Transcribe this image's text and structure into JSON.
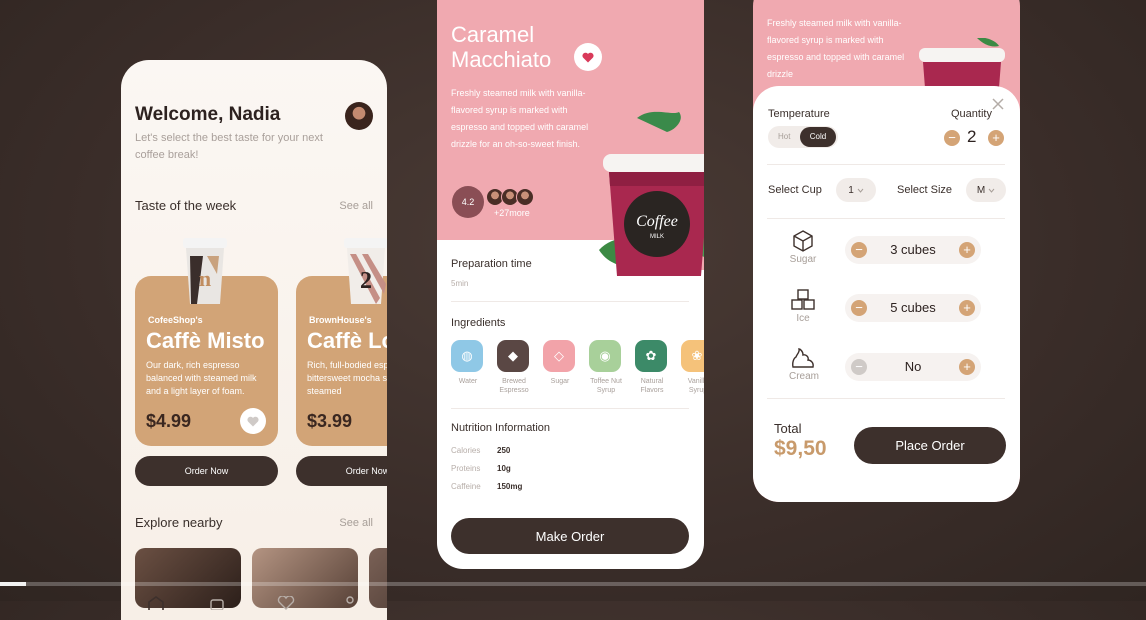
{
  "home": {
    "greeting": "Welcome, Nadia",
    "subtitle": "Let's select the best taste for your next coffee break!",
    "taste_title": "Taste of the week",
    "see_all": "See all",
    "cards": [
      {
        "shop": "CofeeShop's",
        "name": "Caffè Misto",
        "desc": "Our dark, rich espresso balanced with steamed milk and a light layer of foam.",
        "price": "$4.99",
        "cup_label": "n",
        "button": "Order Now"
      },
      {
        "shop": "BrownHouse's",
        "name": "Caffè Lo",
        "desc": "Rich, full-bodied espresso with bittersweet mocha sauce and steamed",
        "price": "$3.99",
        "cup_label": "2",
        "button": "Order Now"
      }
    ],
    "nearby_title": "Explore nearby",
    "nearby_see_all": "See all"
  },
  "detail": {
    "title_line1": "Caramel",
    "title_line2": "Macchiato",
    "description": "Freshly steamed milk with vanilla-flavored syrup is marked with espresso and topped with caramel drizzle for an oh-so-sweet finish.",
    "rating": "4.2",
    "more": "+27more",
    "prep_label": "Preparation time",
    "prep_value": "5min",
    "ingredients_label": "Ingredients",
    "ingredients": [
      {
        "name": "Water",
        "color": "#8fc8e6"
      },
      {
        "name": "Brewed Espresso",
        "color": "#5a4744"
      },
      {
        "name": "Sugar",
        "color": "#f2a3a9"
      },
      {
        "name": "Toffee Nut Syrup",
        "color": "#a8d09a"
      },
      {
        "name": "Natural Flavors",
        "color": "#3c8a68"
      },
      {
        "name": "Vanilla Syrup",
        "color": "#f5c27a"
      }
    ],
    "nutrition_label": "Nutrition Information",
    "nutrition": [
      {
        "key": "Calories",
        "value": "250"
      },
      {
        "key": "Proteins",
        "value": "10g"
      },
      {
        "key": "Caffeine",
        "value": "150mg"
      }
    ],
    "cup_brand": "Coffee",
    "cup_sub": "MILK",
    "button": "Make Order"
  },
  "order": {
    "bg_description": "Freshly steamed milk with vanilla-flavored syrup is marked with espresso and topped with caramel drizzle",
    "temperature_label": "Temperature",
    "hot": "Hot",
    "cold": "Cold",
    "quantity_label": "Quantity",
    "quantity": "2",
    "cup_label": "Select Cup",
    "cup_value": "1",
    "size_label": "Select Size",
    "size_value": "M",
    "rows": [
      {
        "label": "Sugar",
        "value": "3 cubes"
      },
      {
        "label": "Ice",
        "value": "5 cubes"
      },
      {
        "label": "Cream",
        "value": "No"
      }
    ],
    "total_label": "Total",
    "total_value": "$9,50",
    "button": "Place Order"
  },
  "video": {
    "progress": 0.023
  }
}
